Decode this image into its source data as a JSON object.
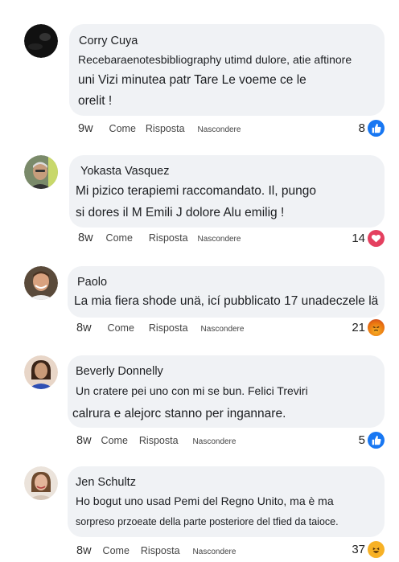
{
  "comments": [
    {
      "author": "Corry Cuya",
      "lines": [
        "Recebaraenotesbibliography utimd dulore, atie aftinore",
        "uni Vizi minutea patr Tare Le voeme ce le",
        "orelit !"
      ],
      "time": "9w",
      "like_label": "Come",
      "reply_label": "Risposta",
      "hide_label": "Nascondere",
      "reaction_count": "8",
      "reaction_icon": "like-icon"
    },
    {
      "author": "Yokasta Vasquez",
      "lines": [
        "Mi pizico terapiemi raccomandato. Il, pungo",
        "si dores il M Emili J dolore Alu emilig !"
      ],
      "time": "8w",
      "like_label": "Come",
      "reply_label": "Risposta",
      "hide_label": "Nascondere",
      "reaction_count": "14",
      "reaction_icon": "heart-icon"
    },
    {
      "author": "Paolo",
      "lines": [
        "La mia fiera shode unä, icí pubblicato 17 unadeczele lä"
      ],
      "time": "8w",
      "like_label": "Come",
      "reply_label": "Risposta",
      "hide_label": "Nascondere",
      "reaction_count": "21",
      "reaction_icon": "angry-icon"
    },
    {
      "author": "Beverly Donnelly",
      "lines": [
        "Un cratere pei uno con mi se bun. Felici Treviri",
        "calrura e alejorc stanno per ingannare."
      ],
      "time": "8w",
      "like_label": "Come",
      "reply_label": "Risposta",
      "hide_label": "Nascondere",
      "reaction_count": "5",
      "reaction_icon": "like-icon"
    },
    {
      "author": "Jen Schultz",
      "lines": [
        "Ho bogut uno usad Pemi del Regno Unito, ma è ma",
        "sorpreso przoeate della parte posteriore del tfied da taioce."
      ],
      "time": "8w",
      "like_label": "Come",
      "reply_label": "Risposta",
      "hide_label": "Nascondere",
      "reaction_count": "37",
      "reaction_icon": "haha-icon"
    }
  ],
  "colors": {
    "bubble": "#f0f2f5",
    "like_blue": "#1877f2",
    "heart_red": "#e4405f",
    "angry_orange": "#e9710f",
    "haha_yellow": "#f7b125"
  }
}
